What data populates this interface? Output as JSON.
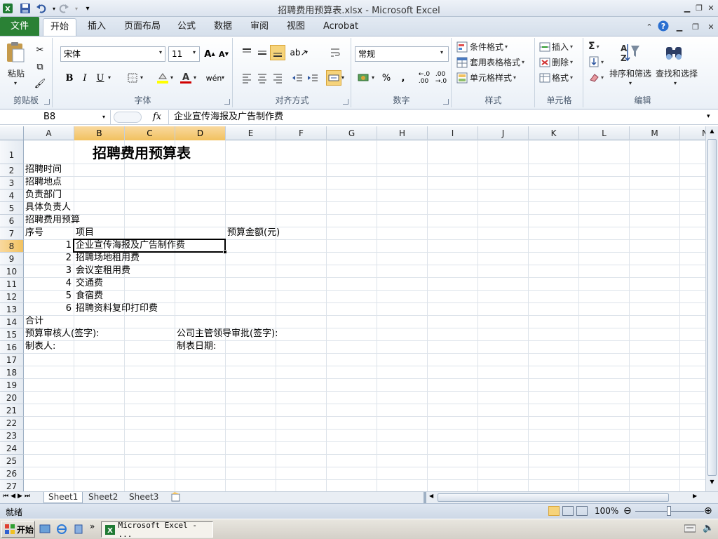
{
  "window": {
    "title": "招聘费用预算表.xlsx - Microsoft Excel"
  },
  "tabs": {
    "file": "文件",
    "home": "开始",
    "insert": "插入",
    "layout": "页面布局",
    "formulas": "公式",
    "data": "数据",
    "review": "审阅",
    "view": "视图",
    "acrobat": "Acrobat"
  },
  "ribbon": {
    "clipboard": {
      "label": "剪贴板",
      "paste": "粘贴"
    },
    "font": {
      "label": "字体",
      "name": "宋体",
      "size": "11",
      "bold": "B",
      "italic": "I",
      "underline": "U"
    },
    "alignment": {
      "label": "对齐方式"
    },
    "number": {
      "label": "数字",
      "format": "常规",
      "percent": "%",
      "comma": ","
    },
    "styles": {
      "label": "样式",
      "conditional": "条件格式",
      "table": "套用表格格式",
      "cell": "单元格样式"
    },
    "cells": {
      "label": "单元格",
      "insert": "插入",
      "delete": "删除",
      "format": "格式"
    },
    "editing": {
      "label": "编辑",
      "sort": "排序和筛选",
      "find": "查找和选择",
      "sum": "Σ"
    }
  },
  "formula_bar": {
    "name_box": "B8",
    "fx": "fx",
    "content": "企业宣传海报及广告制作费"
  },
  "columns": [
    "A",
    "B",
    "C",
    "D",
    "E",
    "F",
    "G",
    "H",
    "I",
    "J",
    "K",
    "L",
    "M",
    "N"
  ],
  "rows": [
    "1",
    "2",
    "3",
    "4",
    "5",
    "6",
    "7",
    "8",
    "9",
    "10",
    "11",
    "12",
    "13",
    "14",
    "15",
    "16",
    "17",
    "18",
    "19",
    "20",
    "21",
    "22",
    "23",
    "24",
    "25",
    "26",
    "27"
  ],
  "cells": {
    "title": "招聘费用预算表",
    "a2": "招聘时间",
    "a3": "招聘地点",
    "a4": "负责部门",
    "a5": "具体负责人",
    "a6": "招聘费用预算",
    "a7": "序号",
    "b7": "项目",
    "e7": "预算金额(元)",
    "items": [
      {
        "no": "1",
        "name": "企业宣传海报及广告制作费"
      },
      {
        "no": "2",
        "name": "招聘场地租用费"
      },
      {
        "no": "3",
        "name": "会议室租用费"
      },
      {
        "no": "4",
        "name": "交通费"
      },
      {
        "no": "5",
        "name": "食宿费"
      },
      {
        "no": "6",
        "name": "招聘资料复印打印费"
      }
    ],
    "a14": "合计",
    "a15": "预算审核人(签字):",
    "d15": "公司主管领导审批(签字):",
    "a16": "制表人:",
    "d16": "制表日期:"
  },
  "sheets": [
    "Sheet1",
    "Sheet2",
    "Sheet3"
  ],
  "status": {
    "ready": "就绪",
    "zoom": "100%"
  },
  "taskbar": {
    "start": "开始",
    "task": "Microsoft Excel - ..."
  },
  "colors": {
    "file_tab": "#2a8135",
    "selected_header": "#f1c15f"
  }
}
